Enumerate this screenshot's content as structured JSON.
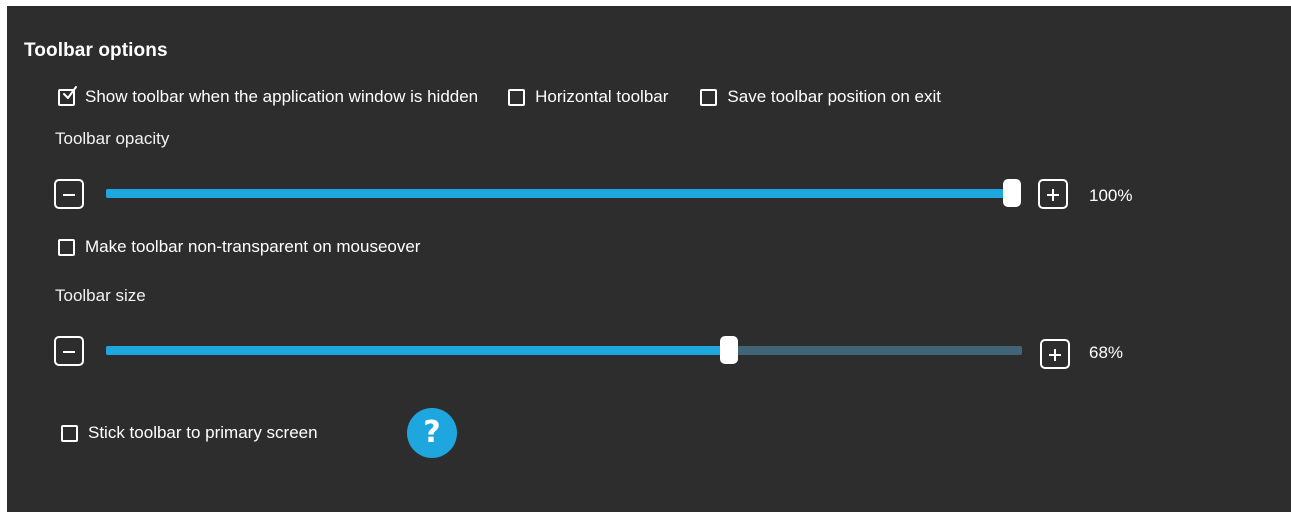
{
  "section": {
    "title": "Toolbar options"
  },
  "options": {
    "show_when_hidden": {
      "label": "Show toolbar when the application window is hidden",
      "checked": true
    },
    "horizontal": {
      "label": "Horizontal toolbar",
      "checked": false
    },
    "save_position": {
      "label": "Save toolbar position on exit",
      "checked": false
    },
    "non_transparent": {
      "label": "Make toolbar non-transparent on mouseover",
      "checked": false
    },
    "stick_primary": {
      "label": "Stick toolbar to primary screen",
      "checked": false
    }
  },
  "opacity": {
    "label": "Toolbar opacity",
    "value": 100,
    "display": "100%"
  },
  "size": {
    "label": "Toolbar size",
    "value": 68,
    "display": "68%"
  },
  "help": {
    "glyph": "?"
  },
  "colors": {
    "background": "#2d2d2d",
    "accent": "#1ea7df",
    "track_empty": "#3f6576",
    "text": "#ffffff"
  }
}
